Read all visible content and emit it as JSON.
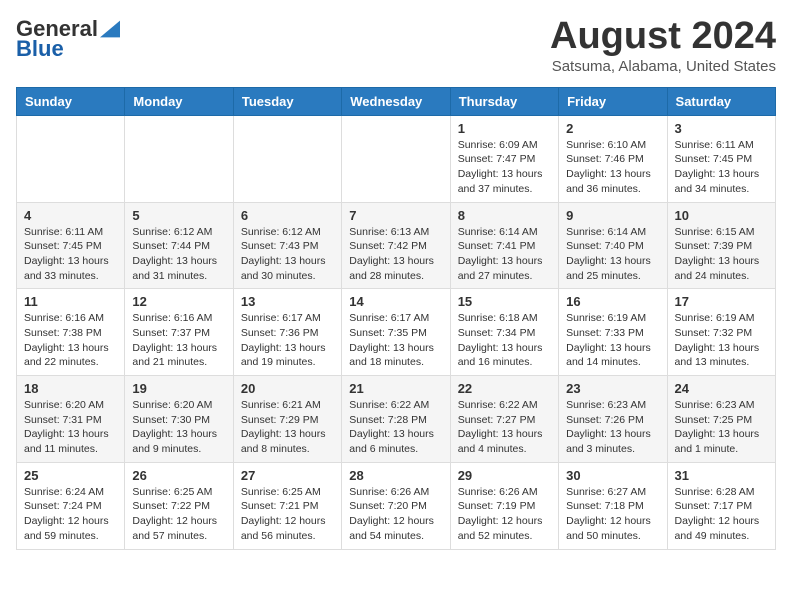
{
  "logo": {
    "general": "General",
    "blue": "Blue"
  },
  "header": {
    "title": "August 2024",
    "subtitle": "Satsuma, Alabama, United States"
  },
  "columns": [
    "Sunday",
    "Monday",
    "Tuesday",
    "Wednesday",
    "Thursday",
    "Friday",
    "Saturday"
  ],
  "weeks": [
    [
      {
        "day": "",
        "info": ""
      },
      {
        "day": "",
        "info": ""
      },
      {
        "day": "",
        "info": ""
      },
      {
        "day": "",
        "info": ""
      },
      {
        "day": "1",
        "info": "Sunrise: 6:09 AM\nSunset: 7:47 PM\nDaylight: 13 hours and 37 minutes."
      },
      {
        "day": "2",
        "info": "Sunrise: 6:10 AM\nSunset: 7:46 PM\nDaylight: 13 hours and 36 minutes."
      },
      {
        "day": "3",
        "info": "Sunrise: 6:11 AM\nSunset: 7:45 PM\nDaylight: 13 hours and 34 minutes."
      }
    ],
    [
      {
        "day": "4",
        "info": "Sunrise: 6:11 AM\nSunset: 7:45 PM\nDaylight: 13 hours and 33 minutes."
      },
      {
        "day": "5",
        "info": "Sunrise: 6:12 AM\nSunset: 7:44 PM\nDaylight: 13 hours and 31 minutes."
      },
      {
        "day": "6",
        "info": "Sunrise: 6:12 AM\nSunset: 7:43 PM\nDaylight: 13 hours and 30 minutes."
      },
      {
        "day": "7",
        "info": "Sunrise: 6:13 AM\nSunset: 7:42 PM\nDaylight: 13 hours and 28 minutes."
      },
      {
        "day": "8",
        "info": "Sunrise: 6:14 AM\nSunset: 7:41 PM\nDaylight: 13 hours and 27 minutes."
      },
      {
        "day": "9",
        "info": "Sunrise: 6:14 AM\nSunset: 7:40 PM\nDaylight: 13 hours and 25 minutes."
      },
      {
        "day": "10",
        "info": "Sunrise: 6:15 AM\nSunset: 7:39 PM\nDaylight: 13 hours and 24 minutes."
      }
    ],
    [
      {
        "day": "11",
        "info": "Sunrise: 6:16 AM\nSunset: 7:38 PM\nDaylight: 13 hours and 22 minutes."
      },
      {
        "day": "12",
        "info": "Sunrise: 6:16 AM\nSunset: 7:37 PM\nDaylight: 13 hours and 21 minutes."
      },
      {
        "day": "13",
        "info": "Sunrise: 6:17 AM\nSunset: 7:36 PM\nDaylight: 13 hours and 19 minutes."
      },
      {
        "day": "14",
        "info": "Sunrise: 6:17 AM\nSunset: 7:35 PM\nDaylight: 13 hours and 18 minutes."
      },
      {
        "day": "15",
        "info": "Sunrise: 6:18 AM\nSunset: 7:34 PM\nDaylight: 13 hours and 16 minutes."
      },
      {
        "day": "16",
        "info": "Sunrise: 6:19 AM\nSunset: 7:33 PM\nDaylight: 13 hours and 14 minutes."
      },
      {
        "day": "17",
        "info": "Sunrise: 6:19 AM\nSunset: 7:32 PM\nDaylight: 13 hours and 13 minutes."
      }
    ],
    [
      {
        "day": "18",
        "info": "Sunrise: 6:20 AM\nSunset: 7:31 PM\nDaylight: 13 hours and 11 minutes."
      },
      {
        "day": "19",
        "info": "Sunrise: 6:20 AM\nSunset: 7:30 PM\nDaylight: 13 hours and 9 minutes."
      },
      {
        "day": "20",
        "info": "Sunrise: 6:21 AM\nSunset: 7:29 PM\nDaylight: 13 hours and 8 minutes."
      },
      {
        "day": "21",
        "info": "Sunrise: 6:22 AM\nSunset: 7:28 PM\nDaylight: 13 hours and 6 minutes."
      },
      {
        "day": "22",
        "info": "Sunrise: 6:22 AM\nSunset: 7:27 PM\nDaylight: 13 hours and 4 minutes."
      },
      {
        "day": "23",
        "info": "Sunrise: 6:23 AM\nSunset: 7:26 PM\nDaylight: 13 hours and 3 minutes."
      },
      {
        "day": "24",
        "info": "Sunrise: 6:23 AM\nSunset: 7:25 PM\nDaylight: 13 hours and 1 minute."
      }
    ],
    [
      {
        "day": "25",
        "info": "Sunrise: 6:24 AM\nSunset: 7:24 PM\nDaylight: 12 hours and 59 minutes."
      },
      {
        "day": "26",
        "info": "Sunrise: 6:25 AM\nSunset: 7:22 PM\nDaylight: 12 hours and 57 minutes."
      },
      {
        "day": "27",
        "info": "Sunrise: 6:25 AM\nSunset: 7:21 PM\nDaylight: 12 hours and 56 minutes."
      },
      {
        "day": "28",
        "info": "Sunrise: 6:26 AM\nSunset: 7:20 PM\nDaylight: 12 hours and 54 minutes."
      },
      {
        "day": "29",
        "info": "Sunrise: 6:26 AM\nSunset: 7:19 PM\nDaylight: 12 hours and 52 minutes."
      },
      {
        "day": "30",
        "info": "Sunrise: 6:27 AM\nSunset: 7:18 PM\nDaylight: 12 hours and 50 minutes."
      },
      {
        "day": "31",
        "info": "Sunrise: 6:28 AM\nSunset: 7:17 PM\nDaylight: 12 hours and 49 minutes."
      }
    ]
  ]
}
